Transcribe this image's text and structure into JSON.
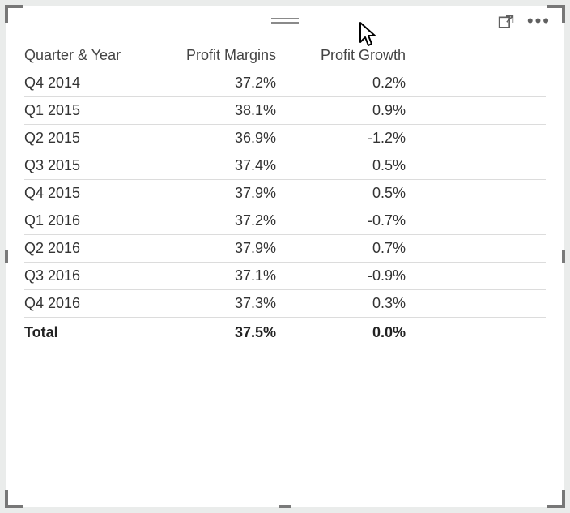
{
  "table": {
    "columns": [
      "Quarter & Year",
      "Profit Margins",
      "Profit Growth"
    ],
    "rows": [
      {
        "period": "Q4 2014",
        "margin": "37.2%",
        "growth": "0.2%"
      },
      {
        "period": "Q1 2015",
        "margin": "38.1%",
        "growth": "0.9%"
      },
      {
        "period": "Q2 2015",
        "margin": "36.9%",
        "growth": "-1.2%"
      },
      {
        "period": "Q3 2015",
        "margin": "37.4%",
        "growth": "0.5%"
      },
      {
        "period": "Q4 2015",
        "margin": "37.9%",
        "growth": "0.5%"
      },
      {
        "period": "Q1 2016",
        "margin": "37.2%",
        "growth": "-0.7%"
      },
      {
        "period": "Q2 2016",
        "margin": "37.9%",
        "growth": "0.7%"
      },
      {
        "period": "Q3 2016",
        "margin": "37.1%",
        "growth": "-0.9%"
      },
      {
        "period": "Q4 2016",
        "margin": "37.3%",
        "growth": "0.3%"
      }
    ],
    "total": {
      "period": "Total",
      "margin": "37.5%",
      "growth": "0.0%"
    }
  },
  "chart_data": {
    "type": "table",
    "title": "",
    "columns": [
      "Quarter & Year",
      "Profit Margins",
      "Profit Growth"
    ],
    "categories": [
      "Q4 2014",
      "Q1 2015",
      "Q2 2015",
      "Q3 2015",
      "Q4 2015",
      "Q1 2016",
      "Q2 2016",
      "Q3 2016",
      "Q4 2016"
    ],
    "series": [
      {
        "name": "Profit Margins",
        "unit": "%",
        "values": [
          37.2,
          38.1,
          36.9,
          37.4,
          37.9,
          37.2,
          37.9,
          37.1,
          37.3
        ]
      },
      {
        "name": "Profit Growth",
        "unit": "%",
        "values": [
          0.2,
          0.9,
          -1.2,
          0.5,
          0.5,
          -0.7,
          0.7,
          -0.9,
          0.3
        ]
      }
    ],
    "totals": {
      "Profit Margins": 37.5,
      "Profit Growth": 0.0
    }
  }
}
